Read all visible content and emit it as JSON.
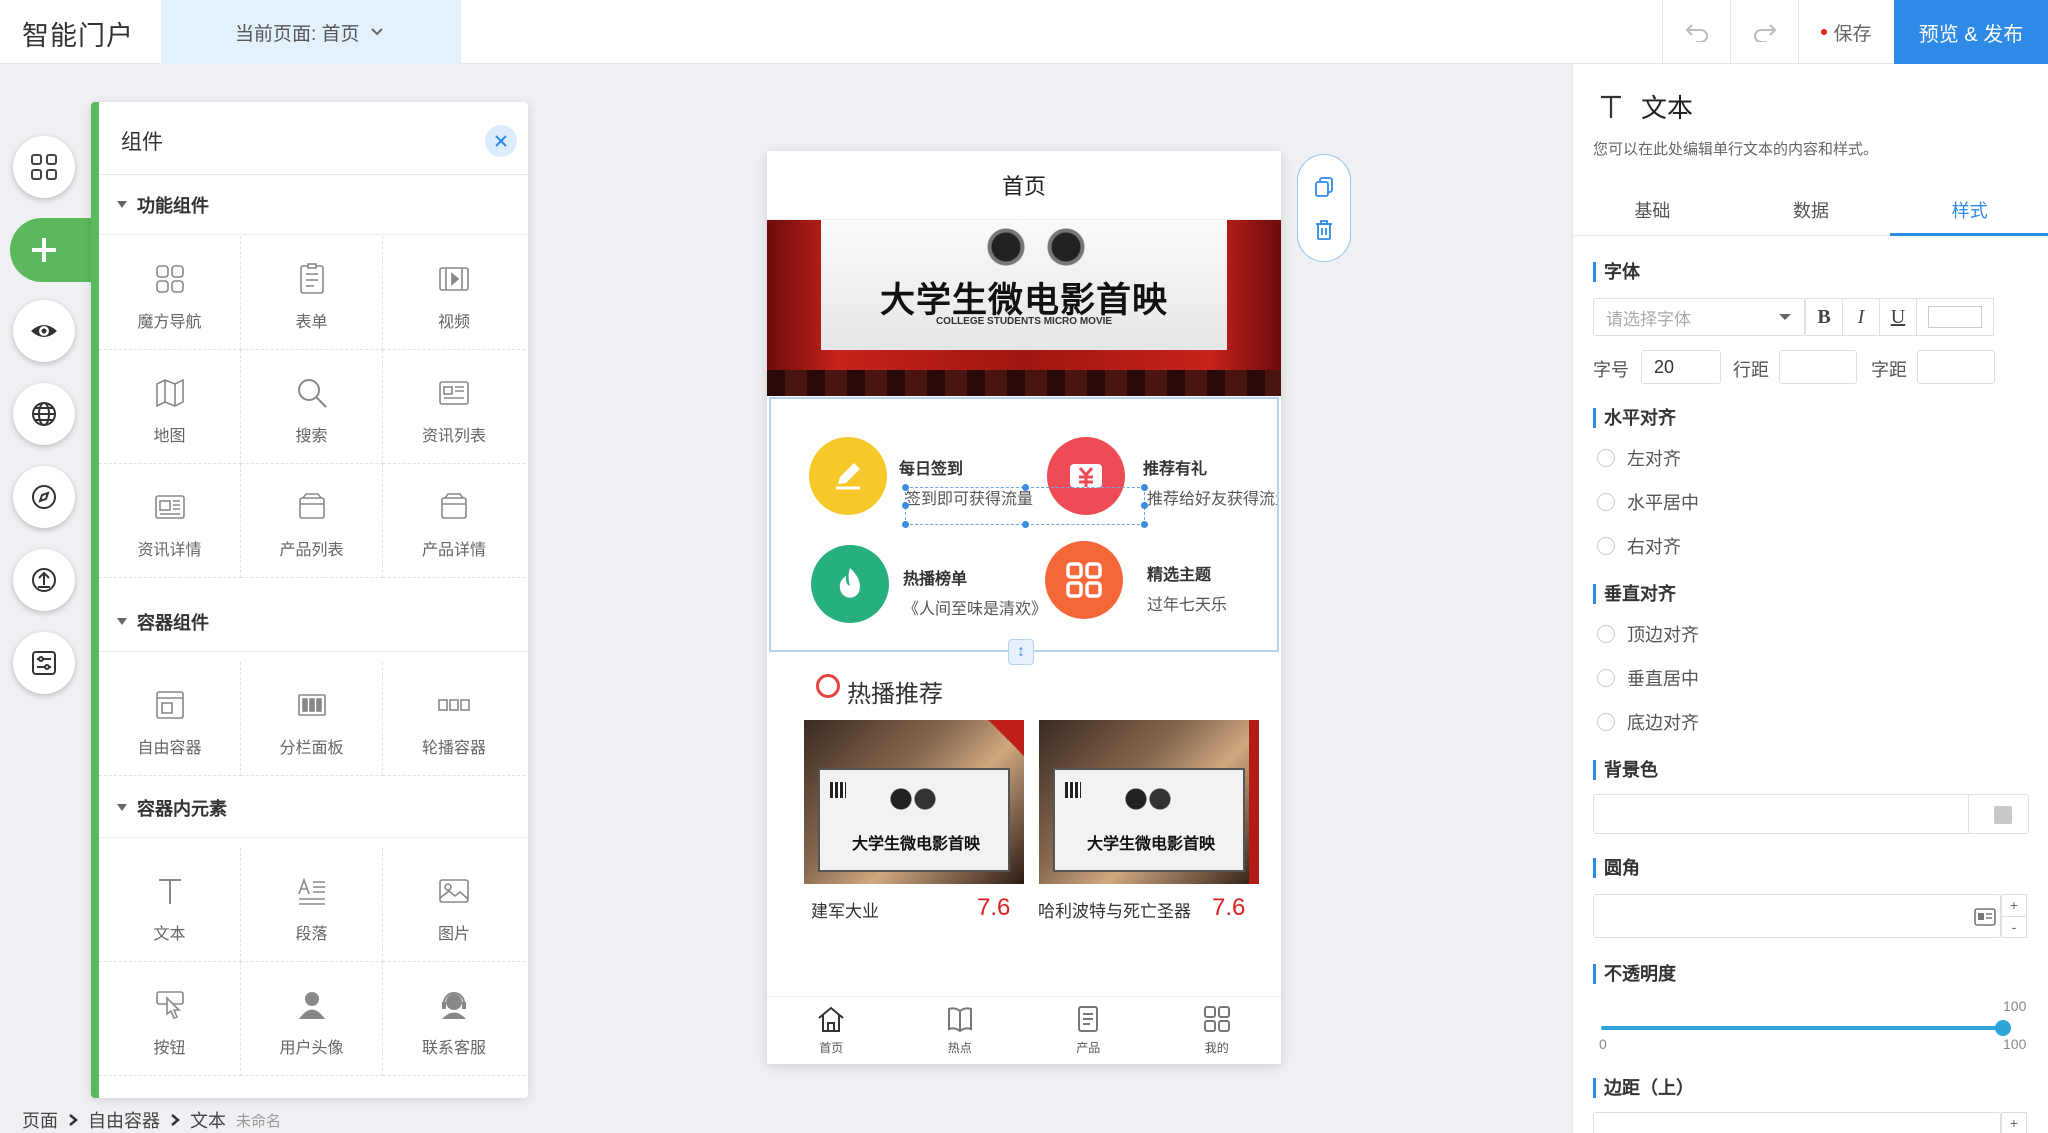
{
  "header": {
    "app_title": "智能门户",
    "page_selector": "当前页面: 首页",
    "save_label": "保存",
    "publish_label": "预览 & 发布"
  },
  "rail": {
    "icons": [
      "grid-icon",
      "plus-icon",
      "eye-icon",
      "globe-icon",
      "compass-icon",
      "upload-icon",
      "settings-panel-icon"
    ]
  },
  "components": {
    "title": "组件",
    "sections": [
      {
        "title": "功能组件",
        "items": [
          "魔方导航",
          "表单",
          "视频",
          "地图",
          "搜索",
          "资讯列表",
          "资讯详情",
          "产品列表",
          "产品详情"
        ]
      },
      {
        "title": "容器组件",
        "items": [
          "自由容器",
          "分栏面板",
          "轮播容器"
        ]
      },
      {
        "title": "容器内元素",
        "items": [
          "文本",
          "段落",
          "图片",
          "按钮",
          "用户头像",
          "联系客服"
        ]
      }
    ]
  },
  "phone": {
    "title": "首页",
    "banner": {
      "main": "大学生微电影首映",
      "sub": "COLLEGE STUDENTS MICRO MOVIE"
    },
    "features": [
      {
        "title": "每日签到",
        "desc": "签到即可获得流量",
        "color": "#f7c82a"
      },
      {
        "title": "推荐有礼",
        "desc": "推荐给好友获得流量",
        "color": "#ee4b54"
      },
      {
        "title": "热播榜单",
        "desc": "《人间至味是清欢》",
        "color": "#27b07e"
      },
      {
        "title": "精选主题",
        "desc": "过年七天乐",
        "color": "#f5683a"
      }
    ],
    "hot": {
      "title": "热播推荐",
      "movies": [
        {
          "name": "建军大业",
          "score": "7.6",
          "poster_text": "大学生微电影首映"
        },
        {
          "name": "哈利波特与死亡圣器",
          "score": "7.6",
          "poster_text": "大学生微电影首映"
        }
      ]
    },
    "tabs": [
      "首页",
      "热点",
      "产品",
      "我的"
    ]
  },
  "breadcrumb": {
    "items": [
      "页面",
      "自由容器",
      "文本"
    ],
    "sub": "未命名"
  },
  "props": {
    "title": "文本",
    "desc": "您可以在此处编辑单行文本的内容和样式。",
    "tabs": [
      "基础",
      "数据",
      "样式"
    ],
    "active_tab": "样式",
    "font": {
      "label": "字体",
      "placeholder": "请选择字体",
      "bold": "B",
      "italic": "I",
      "underline": "U",
      "size_label": "字号",
      "size_value": "20",
      "line_label": "行距",
      "spacing_label": "字距"
    },
    "halign": {
      "label": "水平对齐",
      "options": [
        "左对齐",
        "水平居中",
        "右对齐"
      ]
    },
    "valign": {
      "label": "垂直对齐",
      "options": [
        "顶边对齐",
        "垂直居中",
        "底边对齐"
      ]
    },
    "bg": {
      "label": "背景色"
    },
    "radius": {
      "label": "圆角"
    },
    "opacity": {
      "label": "不透明度",
      "value": "100",
      "min": "0",
      "max": "100"
    },
    "margin": {
      "label": "边距（上）"
    }
  }
}
